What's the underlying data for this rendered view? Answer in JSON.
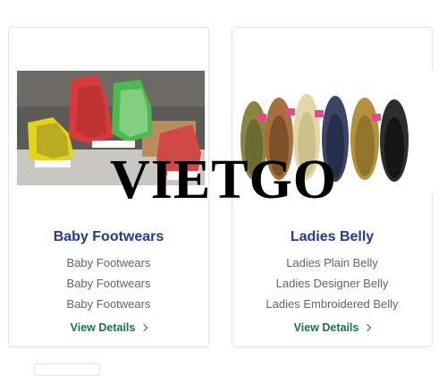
{
  "cards": [
    {
      "title": "Baby Footwears",
      "items": [
        "Baby Footwears",
        "Baby Footwears",
        "Baby Footwears"
      ],
      "link": "View Details"
    },
    {
      "title": "Ladies Belly",
      "items": [
        "Ladies Plain Belly",
        "Ladies Designer Belly",
        "Ladies Embroidered Belly"
      ],
      "link": "View Details"
    }
  ],
  "watermark": "VIETGO",
  "icons": {
    "link_arrow": "chevron-right-icon"
  },
  "colors": {
    "title": "#263a8a",
    "link": "#1e6e5b",
    "text": "#666666"
  }
}
